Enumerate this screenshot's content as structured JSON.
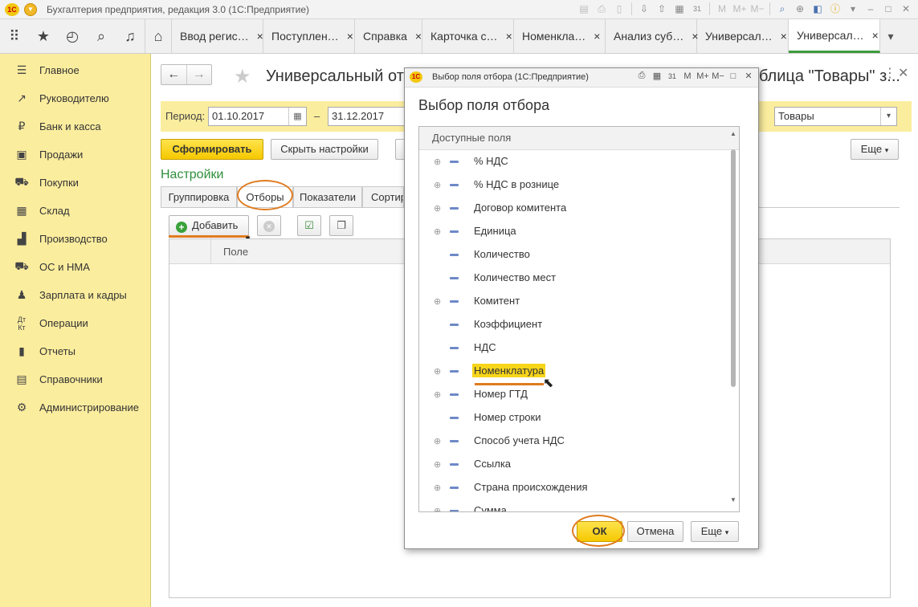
{
  "app": {
    "title": "Бухгалтерия предприятия, редакция 3.0  (1С:Предприятие)",
    "logo_text": "1С"
  },
  "titlebar_icons": [
    "save-icon",
    "print-icon",
    "preview-icon",
    "import-icon",
    "export-icon",
    "calculator-icon",
    "calendar-icon",
    "memory-m",
    "memory-m-plus",
    "memory-m-minus",
    "search-icon",
    "zoom-icon",
    "panel-icon",
    "info-icon",
    "minimize-icon",
    "restore-icon",
    "close-icon"
  ],
  "titlebar_glyphs": {
    "m": "M",
    "mplus": "M+",
    "mminus": "M−",
    "calendar": "31"
  },
  "tabs": [
    {
      "label": "Ввод регис…"
    },
    {
      "label": "Поступлен…"
    },
    {
      "label": "Справка"
    },
    {
      "label": "Карточка с…"
    },
    {
      "label": "Номенкла…"
    },
    {
      "label": "Анализ суб…"
    },
    {
      "label": "Универсал…"
    },
    {
      "label": "Универсал…"
    }
  ],
  "tab_close": "×",
  "sidebar": {
    "items": [
      {
        "label": "Главное",
        "icon": "menu-icon"
      },
      {
        "label": "Руководителю",
        "icon": "trend-icon"
      },
      {
        "label": "Банк и касса",
        "icon": "ruble-icon"
      },
      {
        "label": "Продажи",
        "icon": "sales-icon"
      },
      {
        "label": "Покупки",
        "icon": "cart-icon"
      },
      {
        "label": "Склад",
        "icon": "warehouse-icon"
      },
      {
        "label": "Производство",
        "icon": "factory-icon"
      },
      {
        "label": "ОС и НМА",
        "icon": "truck-icon"
      },
      {
        "label": "Зарплата и кадры",
        "icon": "person-icon"
      },
      {
        "label": "Операции",
        "icon": "operations-icon"
      },
      {
        "label": "Отчеты",
        "icon": "reports-icon"
      },
      {
        "label": "Справочники",
        "icon": "book-icon"
      },
      {
        "label": "Администрирование",
        "icon": "gear-icon"
      }
    ]
  },
  "report": {
    "title_left": "Универсальный отч",
    "title_right": "блица \"Товары\" з...",
    "period_label": "Период:",
    "date_from": "01.10.2017",
    "date_dash": "–",
    "date_to": "31.12.2017",
    "source_value": "Товары",
    "generate_btn": "Сформировать",
    "hide_settings_btn": "Скрыть настройки",
    "more_btn": "Еще",
    "settings_title": "Настройки",
    "settings_tabs": [
      "Группировка",
      "Отборы",
      "Показатели",
      "Сортир"
    ],
    "add_btn": "Добавить",
    "column_field": "Поле"
  },
  "dialog": {
    "window_title": "Выбор поля отбора  (1С:Предприятие)",
    "heading": "Выбор поля отбора",
    "tree_header": "Доступные поля",
    "fields": [
      {
        "label": "% НДС",
        "expandable": true
      },
      {
        "label": "% НДС в рознице",
        "expandable": true
      },
      {
        "label": "Договор комитента",
        "expandable": true
      },
      {
        "label": "Единица",
        "expandable": true
      },
      {
        "label": "Количество",
        "expandable": false
      },
      {
        "label": "Количество мест",
        "expandable": false
      },
      {
        "label": "Комитент",
        "expandable": true
      },
      {
        "label": "Коэффициент",
        "expandable": false
      },
      {
        "label": "НДС",
        "expandable": false
      },
      {
        "label": "Номенклатура",
        "expandable": true,
        "selected": true
      },
      {
        "label": "Номер ГТД",
        "expandable": true
      },
      {
        "label": "Номер строки",
        "expandable": false
      },
      {
        "label": "Способ учета НДС",
        "expandable": true
      },
      {
        "label": "Ссылка",
        "expandable": true
      },
      {
        "label": "Страна происхождения",
        "expandable": true
      },
      {
        "label": "Сумма",
        "expandable": true
      }
    ],
    "ok_btn": "ОК",
    "cancel_btn": "Отмена",
    "more_btn": "Еще"
  },
  "colors": {
    "sidebar_bg": "#fbed9e",
    "accent_yellow": "#f5c800",
    "highlight_orange": "#e07b1f",
    "settings_green": "#2f8f3a"
  }
}
